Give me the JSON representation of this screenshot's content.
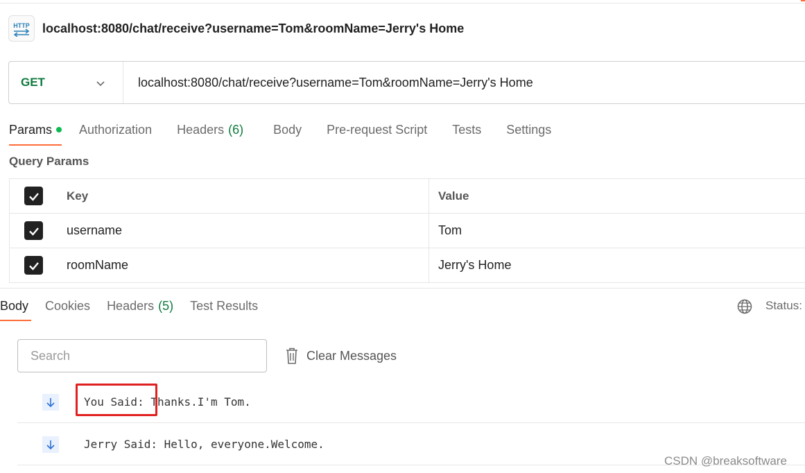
{
  "request": {
    "title": "localhost:8080/chat/receive?username=Tom&roomName=Jerry's Home",
    "method": "GET",
    "url": "localhost:8080/chat/receive?username=Tom&roomName=Jerry's Home",
    "icon": "http-icon"
  },
  "request_tabs": [
    {
      "label": "Params",
      "active": true,
      "dot": true
    },
    {
      "label": "Authorization"
    },
    {
      "label": "Headers",
      "count": "(6)"
    },
    {
      "label": "Body"
    },
    {
      "label": "Pre-request Script"
    },
    {
      "label": "Tests"
    },
    {
      "label": "Settings"
    }
  ],
  "query_params": {
    "title": "Query Params",
    "columns": {
      "key": "Key",
      "value": "Value"
    },
    "rows": [
      {
        "key": "username",
        "value": "Tom",
        "checked": true
      },
      {
        "key": "roomName",
        "value": "Jerry's Home",
        "checked": true
      }
    ]
  },
  "response_tabs": [
    {
      "label": "Body",
      "active": true
    },
    {
      "label": "Cookies"
    },
    {
      "label": "Headers",
      "count": "(5)"
    },
    {
      "label": "Test Results"
    }
  ],
  "response": {
    "status_label": "Status:",
    "search_placeholder": "Search",
    "clear_label": "Clear Messages",
    "messages": [
      {
        "text": "You Said: Thanks.I'm Tom."
      },
      {
        "text": "Jerry Said: Hello, everyone.Welcome."
      }
    ]
  },
  "watermark": "CSDN @breaksoftware",
  "colors": {
    "accent": "#ff6c37",
    "method_green": "#0e7a3e",
    "dot_green": "#0cbb52",
    "highlight_red": "#e02020"
  }
}
